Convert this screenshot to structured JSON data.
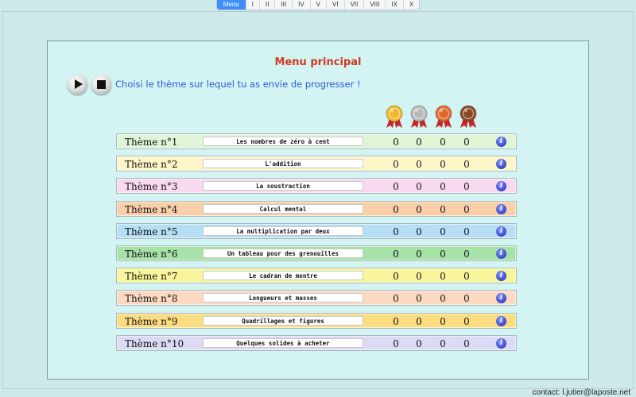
{
  "nav": {
    "tabs": [
      "Menu",
      "I",
      "II",
      "III",
      "IV",
      "V",
      "VI",
      "VII",
      "VIII",
      "IX",
      "X"
    ],
    "active_index": 0,
    "accent": "#3d8ff5"
  },
  "panel": {
    "title": "Menu principal",
    "subtitle": "Choisi le thème sur lequel tu as envie de progresser !",
    "controls": [
      "play-icon",
      "stop-icon"
    ],
    "medals": [
      {
        "name": "gold-medal-icon",
        "color": "#f2b82a"
      },
      {
        "name": "silver-medal-icon",
        "color": "#b9b9b9"
      },
      {
        "name": "bronze-medal-icon",
        "color": "#e0682b"
      },
      {
        "name": "brown-medal-icon",
        "color": "#8a4a24"
      }
    ]
  },
  "themes": [
    {
      "label": "Thème n°1",
      "name": "Les nombres de zéro à cent",
      "scores": [
        "0",
        "0",
        "0",
        "0"
      ],
      "color": "#dff5d5"
    },
    {
      "label": "Thème n°2",
      "name": "L'addition",
      "scores": [
        "0",
        "0",
        "0",
        "0"
      ],
      "color": "#fff6c8"
    },
    {
      "label": "Thème n°3",
      "name": "La soustraction",
      "scores": [
        "0",
        "0",
        "0",
        "0"
      ],
      "color": "#f9d9ef"
    },
    {
      "label": "Thème n°4",
      "name": "Calcul mental",
      "scores": [
        "0",
        "0",
        "0",
        "0"
      ],
      "color": "#f9cfaa"
    },
    {
      "label": "Thème n°5",
      "name": "La multiplication par deux",
      "scores": [
        "0",
        "0",
        "0",
        "0"
      ],
      "color": "#b6dff5"
    },
    {
      "label": "Thème n°6",
      "name": "Un tableau pour des grenouilles",
      "scores": [
        "0",
        "0",
        "0",
        "0"
      ],
      "color": "#a7e2a8"
    },
    {
      "label": "Thème n°7",
      "name": "Le cadran de montre",
      "scores": [
        "0",
        "0",
        "0",
        "0"
      ],
      "color": "#f8f69a"
    },
    {
      "label": "Thème n°8",
      "name": "Longueurs et masses",
      "scores": [
        "0",
        "0",
        "0",
        "0"
      ],
      "color": "#fbd9c2"
    },
    {
      "label": "Thème n°9",
      "name": "Quadrillages et figures",
      "scores": [
        "0",
        "0",
        "0",
        "0"
      ],
      "color": "#fbdc80"
    },
    {
      "label": "Thème n°10",
      "name": "Quelques solides à acheter",
      "scores": [
        "0",
        "0",
        "0",
        "0"
      ],
      "color": "#dcdaf5"
    }
  ],
  "footer": {
    "contact": "contact: l.jutier@laposte.net"
  }
}
